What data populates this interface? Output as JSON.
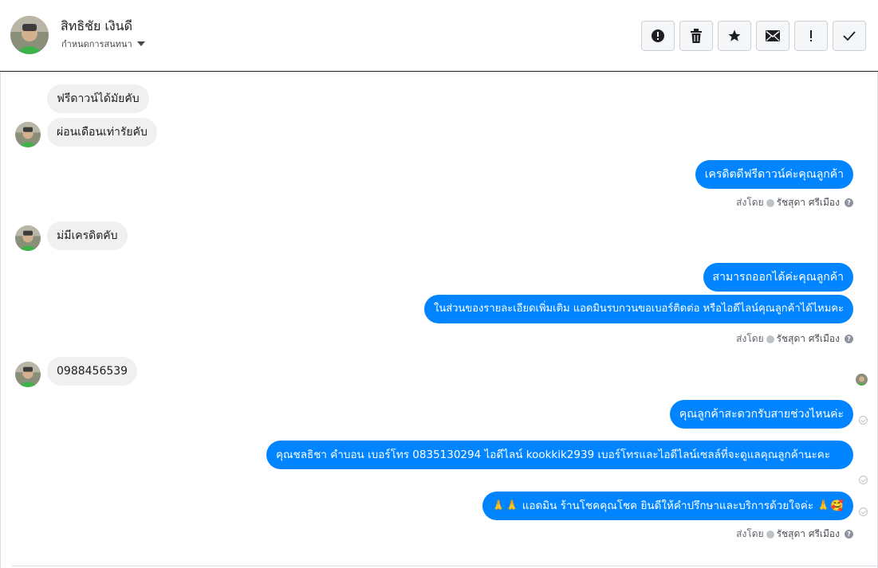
{
  "header": {
    "contact_name": "สิทธิชัย เงินดี",
    "assign_label": "กำหนดการสนทนา",
    "tools": [
      {
        "icon": "spam-alert-icon",
        "label": "!"
      },
      {
        "icon": "trash-icon"
      },
      {
        "icon": "star-icon"
      },
      {
        "icon": "envelope-icon"
      },
      {
        "icon": "exclamation-icon",
        "label": "!"
      },
      {
        "icon": "checkmark-icon"
      }
    ]
  },
  "messages": {
    "in_1": "ฟรีดาวน์ได้มัยคับ",
    "in_2": "ผ่อนเดือนเท่ารัยคับ",
    "out_1": "เครดิตดีฟรีดาวน์ค่ะคุณลูกค้า",
    "sent_by_1": {
      "prefix": "ส่งโดย",
      "name": "รัชสุดา ศรีเมือง"
    },
    "in_3": "ม่มีเครดิตคับ",
    "out_2": "สามารถออกได้ค่ะคุณลูกค้า",
    "out_3": "ในส่วนของรายละเอียดเพิ่มเติม แอดมินรบกวนขอเบอร์ติดต่อ หรือไอดีไลน์คุณลูกค้าได้ไหมคะ",
    "sent_by_2": {
      "prefix": "ส่งโดย",
      "name": "รัชสุดา ศรีเมือง"
    },
    "in_4": "0988456539",
    "out_4": "คุณลูกค้าสะดวกรับสายช่วงไหนค่ะ",
    "out_5": "คุณชลธิชา คำบอน เบอร์โทร 0835130294  ไอดีไลน์ kookkik2939  เบอร์โทรและไอดีไลน์เซลล์ที่จะดูแลคุณลูกค้านะคะ",
    "out_6_text": "แอดมิน ร้านโชคคุณโชค ยินดีให้คำปรึกษาและบริการด้วยใจค่ะ",
    "out_6_emoji_start": "🙏🙏",
    "out_6_emoji_end": "🙏🥰",
    "sent_by_3": {
      "prefix": "ส่งโดย",
      "name": "รัชสุดา ศรีเมือง"
    }
  },
  "colors": {
    "outgoing_bubble": "#0084ff",
    "incoming_bubble": "#f0f0f0",
    "header_rule": "#1c1e21"
  }
}
